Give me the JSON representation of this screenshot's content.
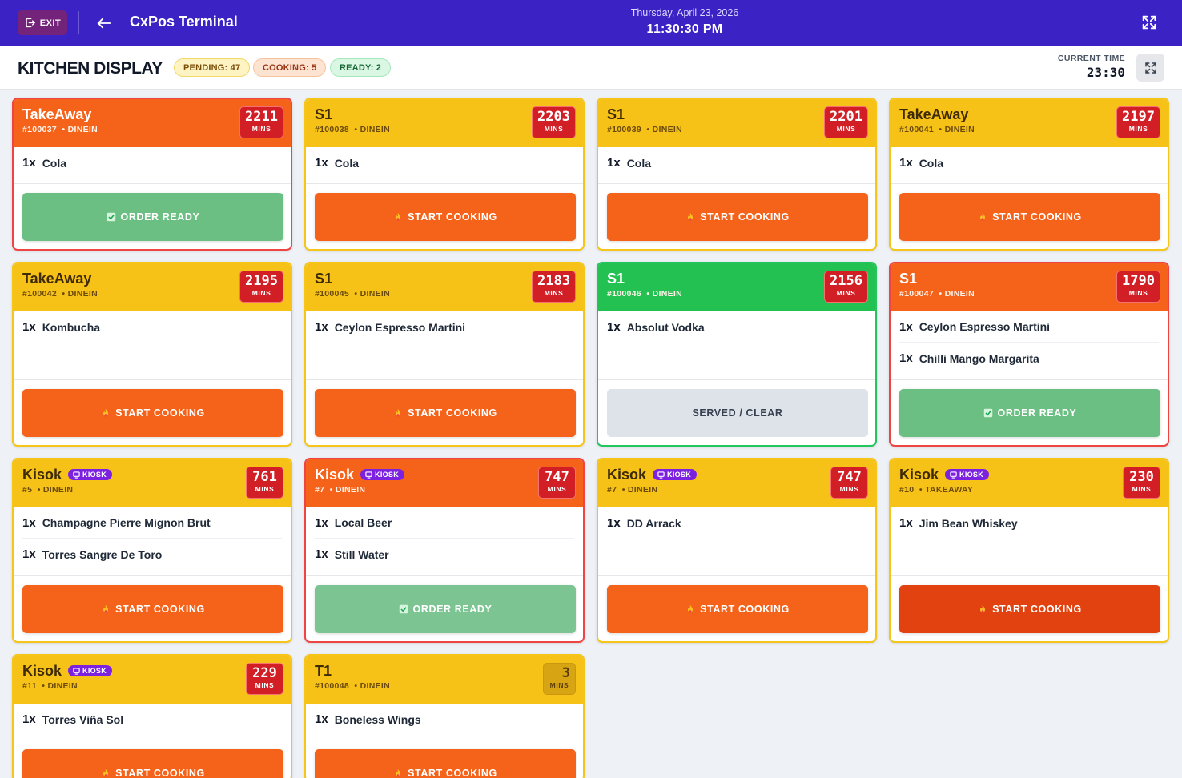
{
  "topbar": {
    "exit_label": "EXIT",
    "title": "CxPos Terminal",
    "date": "Thursday, April 23, 2026",
    "time": "11:30:30 PM"
  },
  "header": {
    "title": "KITCHEN DISPLAY",
    "pending": "PENDING: 47",
    "cooking": "COOKING: 5",
    "ready": "READY: 2",
    "current_time_label": "CURRENT TIME",
    "current_time": "23:30"
  },
  "colors": {
    "topbar": "#3a22c4",
    "header_yellow": "#f6c218",
    "header_orange": "#f5621a",
    "header_green": "#23c152",
    "minutes_red": "#d21f26",
    "kiosk_purple": "#7c21e0"
  },
  "labels": {
    "mins": "MINS",
    "kiosk": "KIOSK",
    "start_cooking": "START COOKING",
    "order_ready": "ORDER READY",
    "served_clear": "SERVED / CLEAR"
  },
  "orders": [
    {
      "name": "TakeAway",
      "ref": "#100037",
      "type": "DINEIN",
      "mins": "2211",
      "items": [
        {
          "qty": "1x",
          "name": "Cola"
        }
      ],
      "action": "ORDER READY"
    },
    {
      "name": "S1",
      "ref": "#100038",
      "type": "DINEIN",
      "mins": "2203",
      "items": [
        {
          "qty": "1x",
          "name": "Cola"
        }
      ],
      "action": "START COOKING"
    },
    {
      "name": "S1",
      "ref": "#100039",
      "type": "DINEIN",
      "mins": "2201",
      "items": [
        {
          "qty": "1x",
          "name": "Cola"
        }
      ],
      "action": "START COOKING"
    },
    {
      "name": "TakeAway",
      "ref": "#100041",
      "type": "DINEIN",
      "mins": "2197",
      "items": [
        {
          "qty": "1x",
          "name": "Cola"
        }
      ],
      "action": "START COOKING"
    },
    {
      "name": "TakeAway",
      "ref": "#100042",
      "type": "DINEIN",
      "mins": "2195",
      "items": [
        {
          "qty": "1x",
          "name": "Kombucha"
        }
      ],
      "action": "START COOKING"
    },
    {
      "name": "S1",
      "ref": "#100045",
      "type": "DINEIN",
      "mins": "2183",
      "items": [
        {
          "qty": "1x",
          "name": "Ceylon Espresso Martini"
        }
      ],
      "action": "START COOKING"
    },
    {
      "name": "S1",
      "ref": "#100046",
      "type": "DINEIN",
      "mins": "2156",
      "items": [
        {
          "qty": "1x",
          "name": "Absolut Vodka"
        }
      ],
      "action": "SERVED / CLEAR"
    },
    {
      "name": "S1",
      "ref": "#100047",
      "type": "DINEIN",
      "mins": "1790",
      "items": [
        {
          "qty": "1x",
          "name": "Ceylon Espresso Martini"
        },
        {
          "qty": "1x",
          "name": "Chilli Mango Margarita"
        }
      ],
      "action": "ORDER READY"
    },
    {
      "name": "Kisok",
      "ref": "#5",
      "type": "DINEIN",
      "mins": "761",
      "items": [
        {
          "qty": "1x",
          "name": "Champagne Pierre Mignon Brut"
        },
        {
          "qty": "1x",
          "name": "Torres Sangre De Toro"
        }
      ],
      "action": "START COOKING"
    },
    {
      "name": "Kisok",
      "ref": "#7",
      "type": "DINEIN",
      "mins": "747",
      "items": [
        {
          "qty": "1x",
          "name": "Local Beer"
        },
        {
          "qty": "1x",
          "name": "Still Water"
        }
      ],
      "action": "ORDER READY"
    },
    {
      "name": "Kisok",
      "ref": "#7",
      "type": "DINEIN",
      "mins": "747",
      "items": [
        {
          "qty": "1x",
          "name": "DD Arrack"
        }
      ],
      "action": "START COOKING"
    },
    {
      "name": "Kisok",
      "ref": "#10",
      "type": "TAKEAWAY",
      "mins": "230",
      "items": [
        {
          "qty": "1x",
          "name": "Jim Bean Whiskey"
        }
      ],
      "action": "START COOKING"
    },
    {
      "name": "Kisok",
      "ref": "#11",
      "type": "DINEIN",
      "mins": "229",
      "items": [
        {
          "qty": "1x",
          "name": "Torres Viña Sol"
        }
      ],
      "action": "START COOKING"
    },
    {
      "name": "T1",
      "ref": "#100048",
      "type": "DINEIN",
      "mins": "3",
      "items": [
        {
          "qty": "1x",
          "name": "Boneless Wings"
        }
      ],
      "action": "START COOKING"
    }
  ]
}
